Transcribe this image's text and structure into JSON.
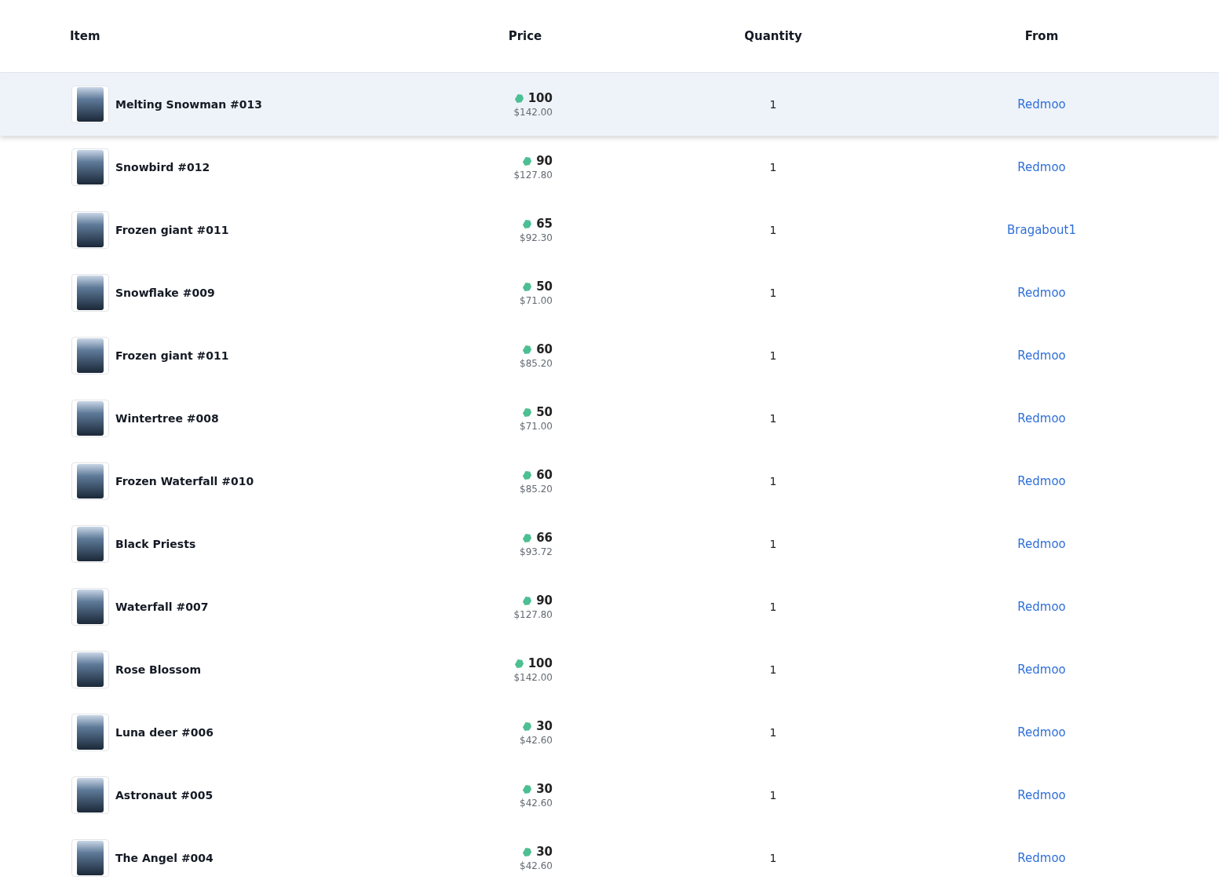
{
  "table": {
    "columns": [
      "Item",
      "Price",
      "Quantity",
      "From"
    ],
    "rows": [
      {
        "item": "Melting Snowman #013",
        "price": "100",
        "usd": "$142.00",
        "quantity": "1",
        "from": "Redmoo",
        "selected": true
      },
      {
        "item": "Snowbird #012",
        "price": "90",
        "usd": "$127.80",
        "quantity": "1",
        "from": "Redmoo",
        "selected": false
      },
      {
        "item": "Frozen giant #011",
        "price": "65",
        "usd": "$92.30",
        "quantity": "1",
        "from": "Bragabout1",
        "selected": false
      },
      {
        "item": "Snowflake #009",
        "price": "50",
        "usd": "$71.00",
        "quantity": "1",
        "from": "Redmoo",
        "selected": false
      },
      {
        "item": "Frozen giant #011",
        "price": "60",
        "usd": "$85.20",
        "quantity": "1",
        "from": "Redmoo",
        "selected": false
      },
      {
        "item": "Wintertree #008",
        "price": "50",
        "usd": "$71.00",
        "quantity": "1",
        "from": "Redmoo",
        "selected": false
      },
      {
        "item": "Frozen Waterfall #010",
        "price": "60",
        "usd": "$85.20",
        "quantity": "1",
        "from": "Redmoo",
        "selected": false
      },
      {
        "item": "Black Priests",
        "price": "66",
        "usd": "$93.72",
        "quantity": "1",
        "from": "Redmoo",
        "selected": false
      },
      {
        "item": "Waterfall #007",
        "price": "90",
        "usd": "$127.80",
        "quantity": "1",
        "from": "Redmoo",
        "selected": false
      },
      {
        "item": "Rose Blossom",
        "price": "100",
        "usd": "$142.00",
        "quantity": "1",
        "from": "Redmoo",
        "selected": false
      },
      {
        "item": "Luna deer #006",
        "price": "30",
        "usd": "$42.60",
        "quantity": "1",
        "from": "Redmoo",
        "selected": false
      },
      {
        "item": "Astronaut #005",
        "price": "30",
        "usd": "$42.60",
        "quantity": "1",
        "from": "Redmoo",
        "selected": false
      },
      {
        "item": "The Angel #004",
        "price": "30",
        "usd": "$42.60",
        "quantity": "1",
        "from": "Redmoo",
        "selected": false
      }
    ]
  }
}
